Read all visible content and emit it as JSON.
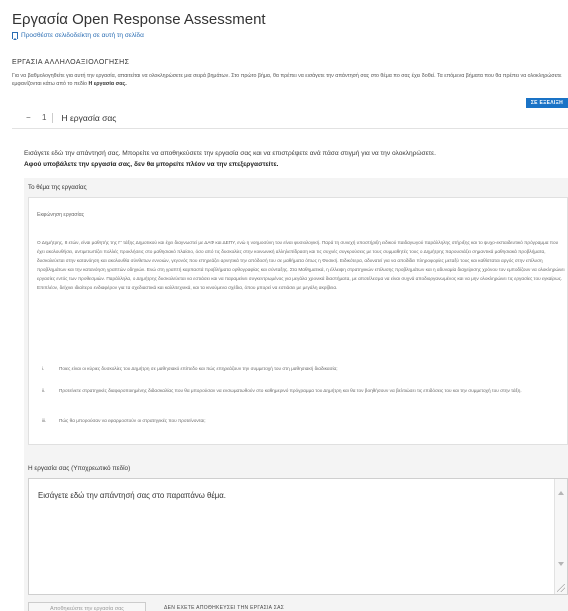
{
  "page": {
    "title": "Εργασία Open Response Assessment",
    "bookmark_label": "Προσθέστε σελιδοδείκτη σε αυτή τη σελίδα"
  },
  "section": {
    "heading": "ΕΡΓΑΣΙΑ ΑΛΛΗΛΟΑΞΙΟΛΟΓΗΣΗΣ",
    "intro_text": "Για να βαθμολογηθείτε για αυτή την εργασία, απαιτείται να ολοκληρώσετε μια σειρά βημάτων. Στο πρώτο βήμα, θα πρέπει να εισάγετε την απάντησή σας στο θέμα πο σας έχει δοθεί. Τα επόμενα βήματα που θα πρέπει να ολοκληρώσετε εμφανίζονται κάτω από το πεδίο",
    "intro_bold": "Η εργασία σας."
  },
  "step": {
    "status_badge": "ΣΕ ΕΞΕΛΙΞΗ",
    "toggle": "−",
    "number": "1",
    "title": "Η εργασία σας"
  },
  "instructions": {
    "line1": "Εισάγετε εδώ την απάντησή σας. Μπορείτε να αποθηκεύσετε την εργασία σας και να επιστρέψετε ανά πάσα στιγμή για να την ολοκληρώσετε.",
    "line2": "Αφού υποβάλετε την εργασία σας, δεν θα μπορείτε πλέον να την επεξεργαστείτε."
  },
  "prompt": {
    "label": "Το θέμα της εργασίας",
    "heading": "Εκφώνηση εργασίας",
    "paragraph": "Ο Δημήτρης, 8 ετών, είναι μαθητής της Γ' τάξης Δημοτικού και έχει διαγνωστεί με ΔΑΦ και ΔΕΠΥ, ενώ η νοημοσύνη του είναι φυσιολογική. Παρά τη συνεχή υποστήριξη ειδικού παιδαγωγού παράλληλης στήριξης και το ψυχο-εκπαιδευτικό πρόγραμμα που έχει ακολουθήσει, αντιμετωπίζει πολλές προκλήσεις στο μαθησιακό πλαίσιο, όσο από τις δυσκολίες στην κοινωνική αλληλεπίδραση και τις συχνές συγκρούσεις με τους συμμαθητές τους ο Δημήτρης παρουσιάζει σημαντικά μαθησιακά προβλήματα, δυσκολεύεται στην κατανόηση και ακολουθία σύνθετων εννοιών, γεγονός που επηρεάζει αρνητικά την απόδοσή του σε μαθήματα όπως η Φυσική. Ειδικότερα, αδυνατεί για να αποδίδει πληροφορίες μεταξύ τους και καθίσταται αργός στην επίλυση προβλημάτων και την κατανόηση γραπτών οδηγιών. Ενώ στη γραπτή καρπαστά προβλήματα ορθογραφίας και σύνταξης. Στα Μαθηματικά, η έλλειψη στρατηγικών επίλυσης προβλημάτων και η αδυναμία διαχείρισης χρόνου τον εμποδίζουν να ολοκληρώνει εργασίες εντός των προθεσμιών. Παράλληλα, ο Δημήτρης δυσκολεύεται να εστιάσει και να παραμείνει συγκεντρωμένος για μεγάλα χρονικά διαστήματα, με αποτέλεσμα να είναι συχνά αποδιοργανωμένος και να μην ολοκληρώνει τις εργασίες του εγκαίρως. Επιπλέον, δείχνει ιδιαίτερο ενδιαφέρον για τα σχεδιαστικά και καλλιτεχνικά, και τα κινούμενα σχέδια, όπου μπορεί να εστιάσει με μεγάλη ακρίβεια.",
    "items": [
      {
        "num": "i.",
        "text": "Ποιες είναι οι κύριες δυσκολίες του Δημήτρη σε μαθησιακό επίπεδο και πώς επηρεάζουν την συμμετοχή του στη μαθησιακή διαδικασία;"
      },
      {
        "num": "ii.",
        "text": "Προτείνετε στρατηγικές διαφοροποιημένης διδασκαλίας που θα μπορούσαν να ενσωματωθούν στο καθημερινό πρόγραμμα του Δημήτρη και θα τον βοηθήσουν να βελτιώσει τις επιδόσεις του και την συμμετοχή του στην τάξη."
      },
      {
        "num": "iii.",
        "text": "Πώς θα μπορούσαν να εφαρμοστούν οι στρατηγικές που προτείνονται;"
      }
    ]
  },
  "answer": {
    "label": "Η εργασία σας (Υποχρεωτικό πεδίο)",
    "placeholder": "Εισάγετε εδώ την απάντησή σας στο παραπάνω θέμα."
  },
  "submit": {
    "button_label": "Αποθηκεύστε την εργασία σας",
    "status_text": "ΔΕΝ ΕΧΕΤΕ ΑΠΟΘΗΚΕΥΣΕΙ ΤΗΝ ΕΡΓΑΣΙΑ ΣΑΣ"
  },
  "colors": {
    "accent": "#1a73c6",
    "link": "#2a6db3",
    "panel_background": "#f4f4f4"
  }
}
